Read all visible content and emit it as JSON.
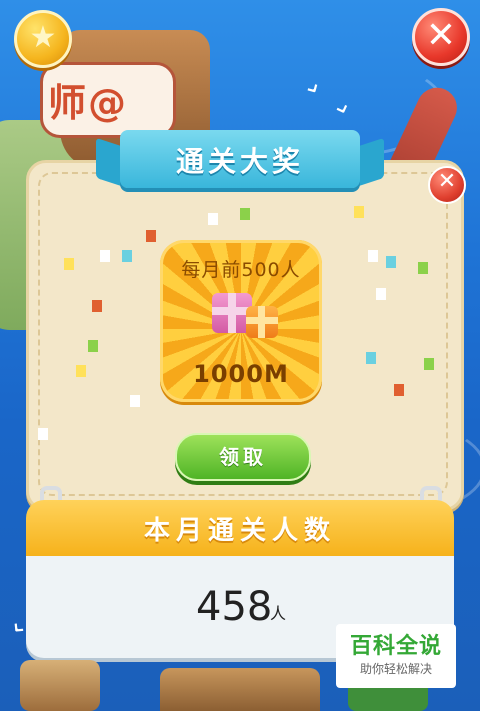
{
  "top_bar": {
    "star_icon": "star-icon",
    "close_icon": "close-icon"
  },
  "background": {
    "ship_sail_text": "师@"
  },
  "dialog": {
    "title": "通关大奖",
    "reward": {
      "heading": "每月前500人",
      "value": "1000M",
      "icon": "gift-icon"
    },
    "claim_label": "领取"
  },
  "count_board": {
    "title": "本月通关人数",
    "count": "458",
    "unit": "人"
  },
  "watermark": {
    "title": "百科全说",
    "subtitle": "助你轻松解决"
  },
  "colors": {
    "sea": "#1f74d6",
    "panel": "#f3e7c9",
    "ribbon": "#39b6db",
    "reward_gold": "#f6a81a",
    "claim_green": "#4fb426",
    "count_header": "#f6b21b"
  }
}
